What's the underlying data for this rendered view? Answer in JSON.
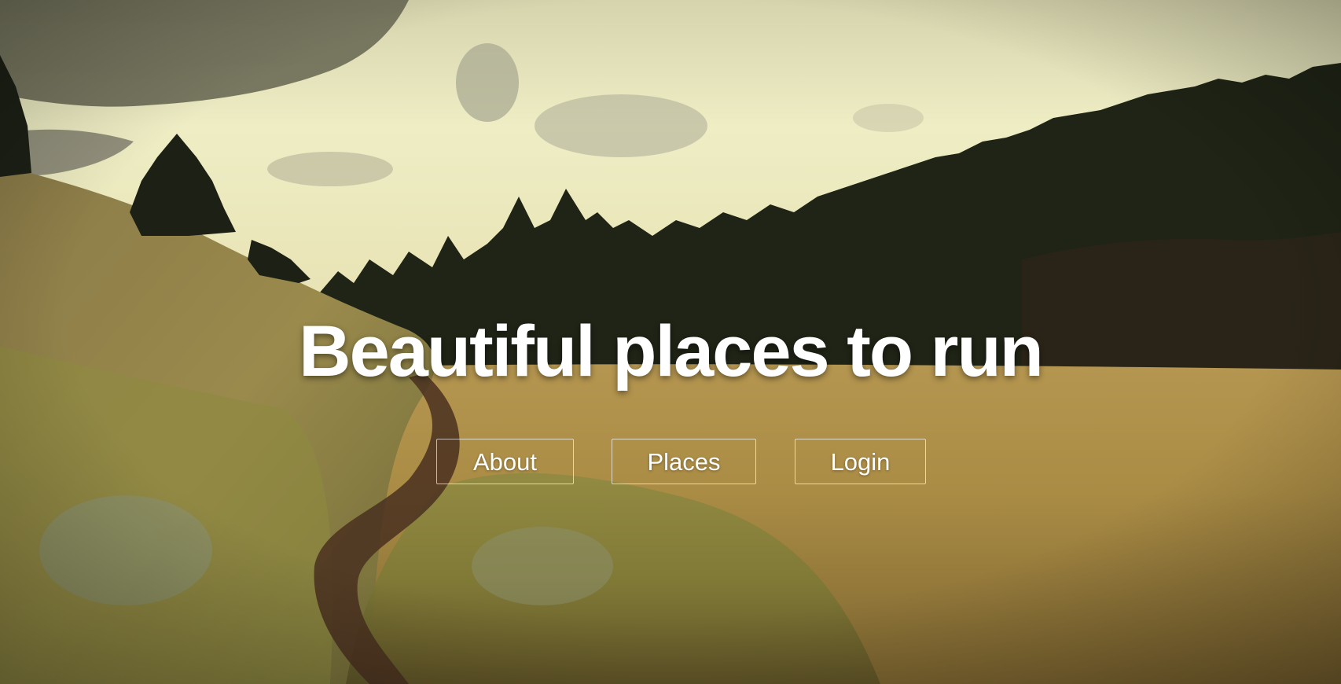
{
  "hero": {
    "title": "Beautiful places to run",
    "nav": [
      {
        "label": "About"
      },
      {
        "label": "Places"
      },
      {
        "label": "Login"
      }
    ]
  },
  "colors": {
    "sky": "#ecebc0",
    "cloud": "#7d7c68",
    "forest": "#1c2015",
    "meadow": "#b18f45",
    "grass": "#8f8a3c",
    "trail": "#4a3020",
    "text": "#ffffff"
  }
}
